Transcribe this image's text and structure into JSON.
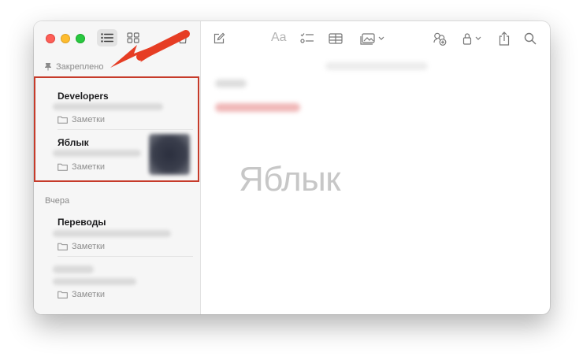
{
  "sidebar": {
    "pinned_section_label": "Закреплено",
    "yesterday_section_label": "Вчера",
    "pinned_notes": [
      {
        "title": "Developers",
        "folder": "Заметки"
      },
      {
        "title": "Яблык",
        "folder": "Заметки"
      }
    ],
    "yesterday_notes": [
      {
        "title": "Переводы",
        "folder": "Заметки"
      },
      {
        "title": "",
        "folder": "Заметки"
      }
    ]
  },
  "toolbar": {
    "format_label": "Aa"
  },
  "editor": {
    "watermark_text": "Яблык"
  },
  "colors": {
    "highlight_border": "#c63b2a",
    "arrow": "#e63d24",
    "close": "#fe5f57",
    "minimize": "#febc2e",
    "zoom": "#28c840"
  },
  "icons": {
    "list_view": "list-view-icon",
    "gallery_view": "gallery-view-icon",
    "trash": "trash-icon",
    "pin": "pin-icon",
    "folder": "folder-icon",
    "new_note": "new-note-icon",
    "checklist": "checklist-icon",
    "table": "table-icon",
    "media": "media-icon",
    "collaborate": "collaborate-icon",
    "lock": "lock-icon",
    "share": "share-icon",
    "search": "search-icon"
  }
}
